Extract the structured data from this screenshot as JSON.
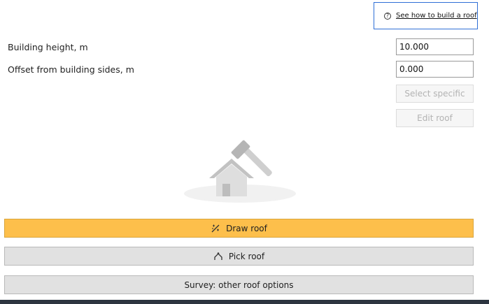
{
  "help": {
    "link_text": "See how to build a roof",
    "icon": "question-circle-icon"
  },
  "fields": {
    "building_height": {
      "label": "Building height, m",
      "value": "10.000"
    },
    "offset": {
      "label": "Offset from building sides, m",
      "value": "0.000"
    }
  },
  "side_buttons": {
    "select_specific": "Select specific",
    "edit_roof": "Edit roof"
  },
  "illustration": {
    "icon": "house-hammer-icon"
  },
  "actions": {
    "draw_roof": {
      "label": "Draw roof",
      "icon": "draw-wand-icon"
    },
    "pick_roof": {
      "label": "Pick roof",
      "icon": "pick-roof-icon"
    },
    "survey": {
      "label": "Survey: other roof options"
    }
  },
  "colors": {
    "accent_primary": "#fdbf4b",
    "secondary_button": "#e1e1e1",
    "help_border": "#2f6fd6",
    "bottom_bar": "#2d3540"
  }
}
